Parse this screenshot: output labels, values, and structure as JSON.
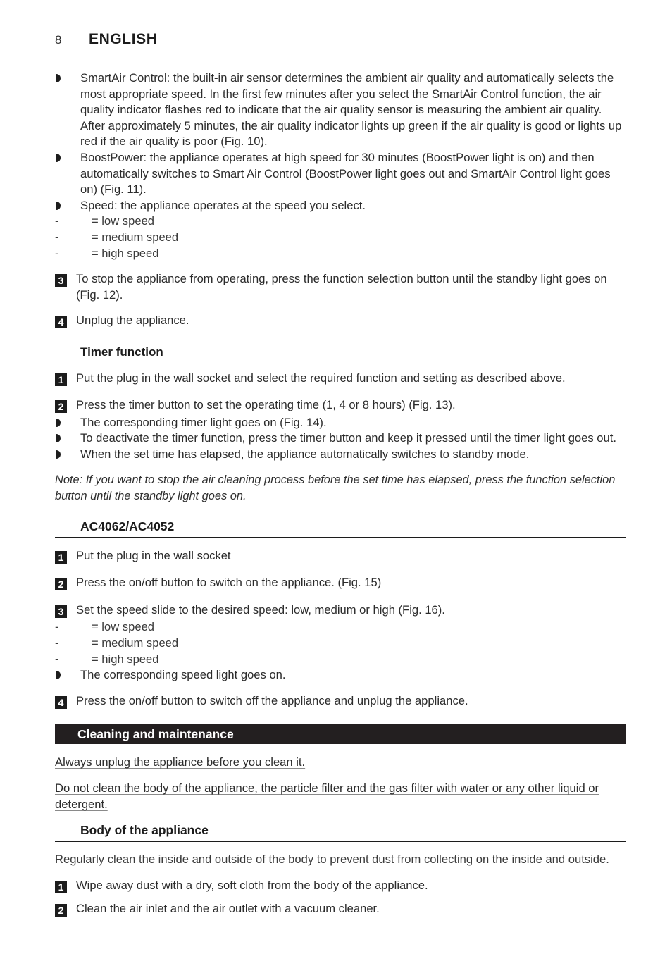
{
  "running_head": {
    "page_number": "8",
    "title": "ENGLISH"
  },
  "markers": {
    "bullet": "half-disc-bullet",
    "dash": "-"
  },
  "sections": {
    "function_bullets": [
      "SmartAir Control: the built-in air sensor determines the ambient air quality and automatically selects the most appropriate speed. In the first few minutes after you select the SmartAir Control function, the air quality indicator flashes red to indicate that the air quality sensor is measuring the ambient air quality. After approximately 5 minutes, the air quality indicator lights up green if the air quality is good or lights up red if the air quality is poor (Fig. 10).",
      "BoostPower: the appliance operates at high speed for 30 minutes (BoostPower light is on) and then automatically switches to Smart Air Control (BoostPower light goes out and SmartAir Control light goes on) (Fig. 11).",
      "Speed: the appliance operates at the speed you select."
    ],
    "speed_list_1": [
      "= low speed",
      "= medium speed",
      "= high speed"
    ],
    "steps_top": [
      {
        "number": "3",
        "text": "To stop the appliance from operating, press the function selection button until the standby light goes on (Fig. 12)."
      },
      {
        "number": "4",
        "text": "Unplug the appliance."
      }
    ],
    "timer": {
      "heading": "Timer function",
      "steps": [
        {
          "number": "1",
          "text": "Put the plug in the wall socket and select the required function and setting as described above."
        },
        {
          "number": "2",
          "text": "Press the timer button to set the operating time (1, 4 or 8 hours) (Fig. 13)."
        }
      ],
      "bullets": [
        "The corresponding timer light goes on (Fig. 14).",
        "To deactivate the timer function, press the timer button and keep it pressed until the timer light goes out.",
        "When the set time has elapsed, the appliance automatically switches to standby mode."
      ],
      "note": "Note: If you want to stop the air cleaning process before the set time has elapsed, press the function selection button until the standby light goes on."
    },
    "model_section": {
      "heading": "AC4062/AC4052",
      "steps": [
        {
          "number": "1",
          "text": "Put the plug in the wall socket"
        },
        {
          "number": "2",
          "text": "Press the on/off button to switch on the appliance.  (Fig. 15)"
        },
        {
          "number": "3",
          "text": "Set the speed slide to the desired speed: low, medium or high (Fig. 16)."
        }
      ],
      "speed_list": [
        "= low speed",
        "= medium speed",
        "= high speed"
      ],
      "bullet": "The corresponding speed light goes on.",
      "final_step": {
        "number": "4",
        "text": "Press the on/off button to switch off the appliance and unplug the appliance."
      }
    },
    "cleaning": {
      "banner": "Cleaning and maintenance",
      "warning_1": "Always unplug the appliance before you clean it.",
      "warning_2": "Do not clean the body of the appliance, the particle filter and the gas filter with water or any other liquid or detergent.",
      "body_heading": "Body of the appliance",
      "body_intro": "Regularly clean the inside and outside of the body to prevent dust from collecting on the inside and outside.",
      "steps": [
        {
          "number": "1",
          "text": "Wipe away dust with a dry, soft cloth from the body of the appliance."
        },
        {
          "number": "2",
          "text": "Clean the air inlet and the air outlet with a vacuum cleaner."
        }
      ]
    }
  },
  "colors": {
    "banner_bg": "#231f20",
    "text": "#2e2e2e",
    "rule": "#1c1c1c"
  }
}
